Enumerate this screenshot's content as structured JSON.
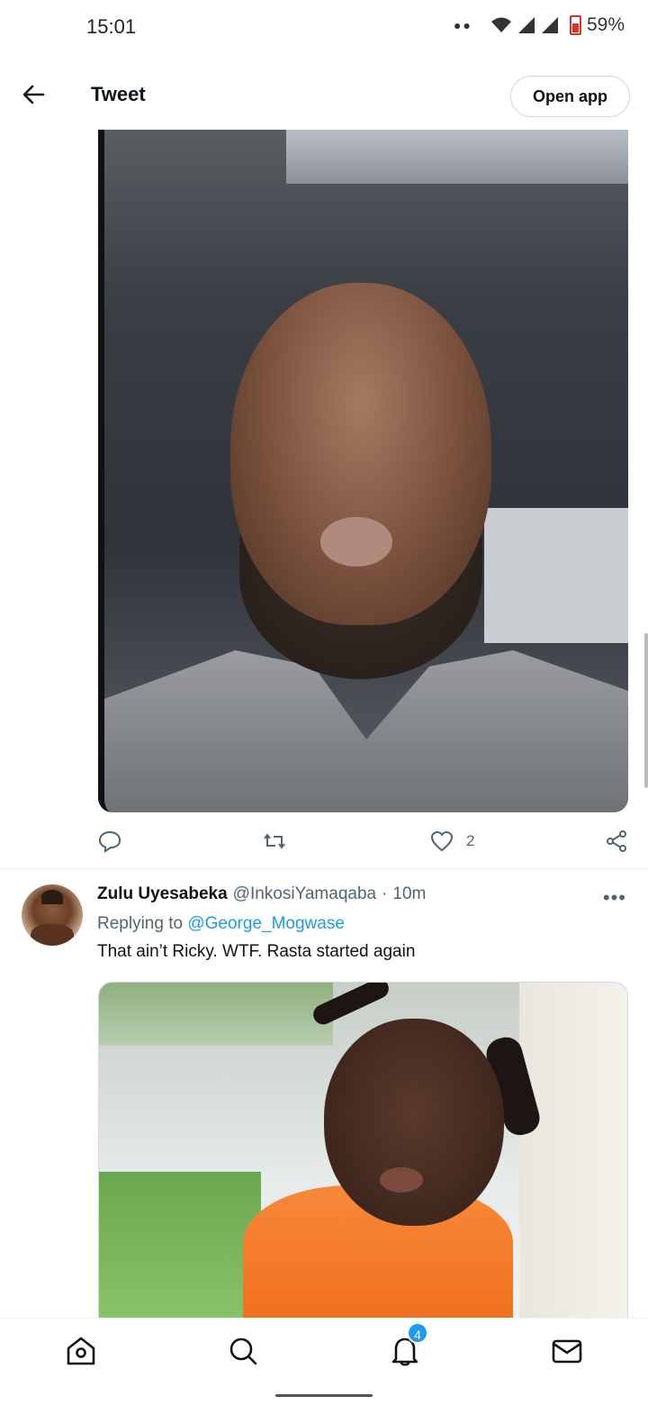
{
  "status_bar": {
    "time": "15:01",
    "battery": "59%"
  },
  "header": {
    "title": "Tweet",
    "open_app_label": "Open app"
  },
  "tweet_actions": {
    "like_count": "2"
  },
  "reply": {
    "display_name": "Zulu Uyesabeka",
    "handle": "@InkosiYamaqaba",
    "separator": "·",
    "time": "10m",
    "replying_prefix": "Replying to",
    "replying_to": "@George_Mogwase",
    "text": "That ain’t Ricky. WTF. Rasta started again",
    "more_label": "•••"
  },
  "bottom_nav": {
    "notifications_badge": "4"
  }
}
